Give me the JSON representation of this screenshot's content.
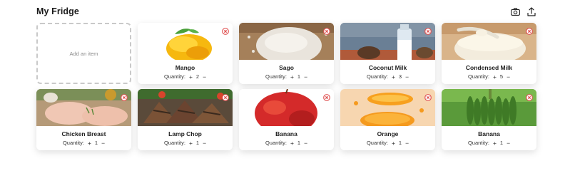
{
  "header": {
    "title": "My Fridge",
    "camera_icon": "camera-icon",
    "share_icon": "share-icon"
  },
  "add_tile": {
    "label": "Add an item"
  },
  "quantity_label": "Quantity:",
  "plus_symbol": "+",
  "minus_symbol": "−",
  "items": [
    {
      "name": "Mango",
      "quantity": "2",
      "image": "mango"
    },
    {
      "name": "Sago",
      "quantity": "1",
      "image": "sago"
    },
    {
      "name": "Coconut Milk",
      "quantity": "3",
      "image": "coconut-milk"
    },
    {
      "name": "Condensed Milk",
      "quantity": "5",
      "image": "condensed-milk"
    },
    {
      "name": "Chicken Breast",
      "quantity": "1",
      "image": "chicken-breast"
    },
    {
      "name": "Lamp Chop",
      "quantity": "1",
      "image": "lamb-chop"
    },
    {
      "name": "Banana",
      "quantity": "1",
      "image": "apple"
    },
    {
      "name": "Orange",
      "quantity": "1",
      "image": "orange"
    },
    {
      "name": "Banana",
      "quantity": "1",
      "image": "banana"
    }
  ],
  "colors": {
    "remove": "#e05555",
    "dashed_border": "#c9c9c9"
  }
}
